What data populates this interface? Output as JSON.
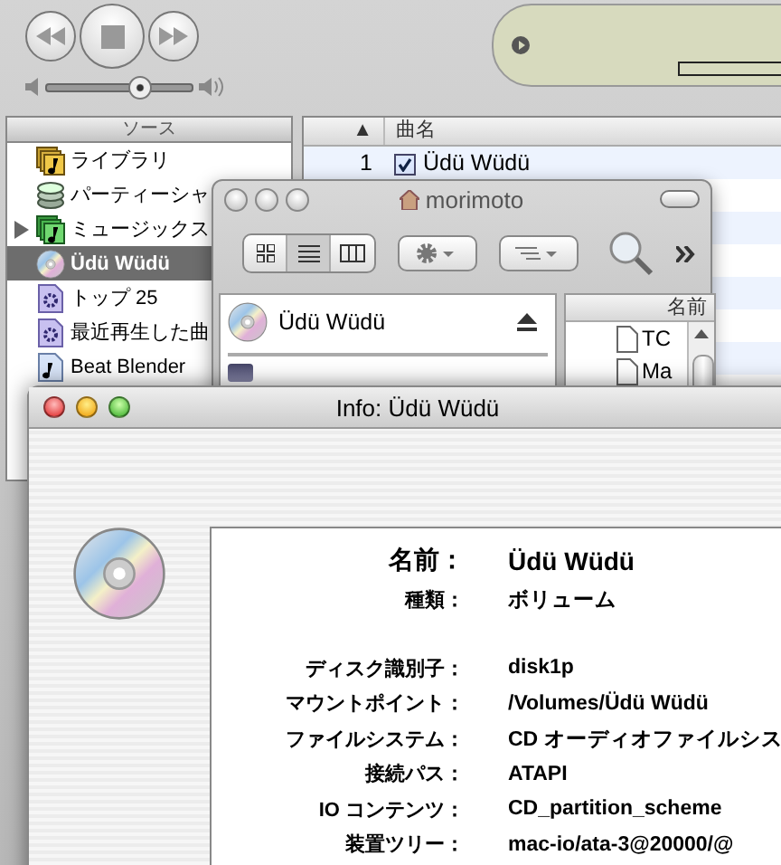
{
  "itunes": {
    "volume": {
      "level": 0.64
    },
    "source_header": "ソース",
    "sources": [
      {
        "label": "ライブラリ",
        "kind": "library",
        "selected": false
      },
      {
        "label": "パーティーシャ",
        "kind": "party",
        "selected": false
      },
      {
        "label": "ミュージックス",
        "kind": "folder",
        "selected": false,
        "expanded": false
      },
      {
        "label": "Üdü Wüdü",
        "kind": "cd",
        "selected": true
      },
      {
        "label": "トップ 25",
        "kind": "smart",
        "selected": false
      },
      {
        "label": "最近再生した曲",
        "kind": "smart",
        "selected": false
      },
      {
        "label": "Beat Blender",
        "kind": "playlist",
        "selected": false
      }
    ],
    "song_list": {
      "columns": [
        "▲",
        "曲名"
      ],
      "rows": [
        {
          "number": "1",
          "checked": true,
          "title": "Üdü Wüdü"
        }
      ]
    }
  },
  "finder": {
    "title": "morimoto",
    "sidebar": [
      {
        "label": "Üdü Wüdü",
        "kind": "cd"
      }
    ],
    "list_header": "名前",
    "files": [
      "TC",
      "Ma"
    ]
  },
  "info": {
    "title": "Info: Üdü Wüdü",
    "general": [
      {
        "label": "名前：",
        "value": "Üdü Wüdü",
        "kind": "name"
      },
      {
        "label": "種類：",
        "value": "ボリューム",
        "kind": "field"
      }
    ],
    "details": [
      {
        "label": "ディスク識別子：",
        "value": "disk1p"
      },
      {
        "label": "マウントポイント：",
        "value": "/Volumes/Üdü Wüdü"
      },
      {
        "label": "ファイルシステム：",
        "value": "CD オーディオファイルシス"
      },
      {
        "label": "接続パス：",
        "value": "ATAPI"
      },
      {
        "label": "IO コンテンツ：",
        "value": "CD_partition_scheme"
      },
      {
        "label": "装置ツリー：",
        "value": "mac-io/ata-3@20000/@"
      }
    ]
  }
}
